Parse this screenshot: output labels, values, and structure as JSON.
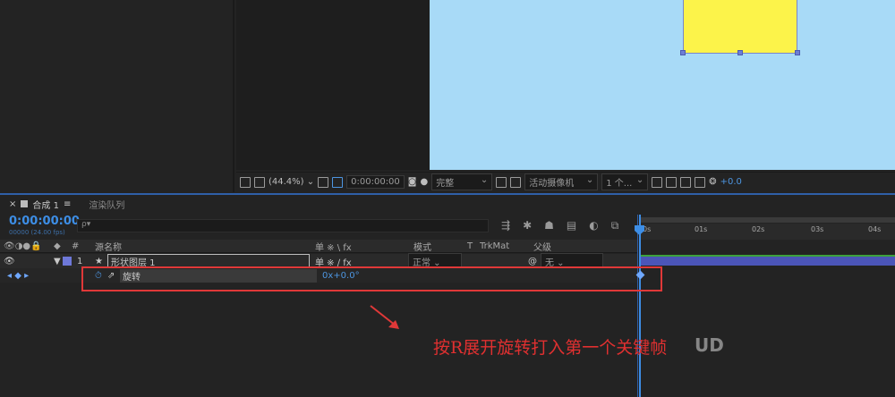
{
  "viewer_toolbar": {
    "zoom": "(44.4%)",
    "timecode": "0:00:00:00",
    "resolution": "完整",
    "camera": "活动摄像机",
    "views": "1 个...",
    "exposure": "+0.0"
  },
  "tabs": [
    {
      "label": "合成 1",
      "close": "×",
      "menu": "≡"
    },
    {
      "label": "渲染队列"
    }
  ],
  "timeline": {
    "timecode": "0:00:00:00",
    "fps": "00000 (24.00 fps)",
    "search_placeholder": "ρ▾",
    "columns": {
      "number": "#",
      "source_name": "源名称",
      "switches": "单 ※ \\ fx",
      "mode": "模式",
      "t": "T",
      "trkmat": "TrkMat",
      "parent": "父级"
    },
    "layer": {
      "index": "1",
      "name": "形状图层 1",
      "mode": "正常",
      "parent": "无"
    },
    "property": {
      "name": "旋转",
      "value": "0x+0.0°"
    },
    "ruler_labels": [
      "0s",
      "01s",
      "02s",
      "03s",
      "04s"
    ]
  },
  "annotation": {
    "caption": "按R展开旋转打入第一个关键帧",
    "watermark": "UD"
  },
  "colors": {
    "accent": "#3d8ee6",
    "layer_bar": "#4b55b8",
    "canvas": "#a8daf7",
    "shape": "#fcf34a",
    "annotation": "#e03838"
  }
}
